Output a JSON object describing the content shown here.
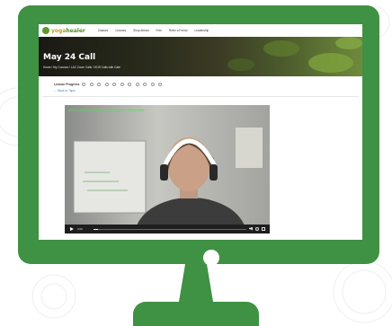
{
  "brand": {
    "logo_prefix": "yoga",
    "logo_suffix": "healer"
  },
  "nav": {
    "items": [
      "Classes",
      "Courses",
      "Shop Ahead",
      "Free",
      "Refer a Friend",
      "Leadership"
    ]
  },
  "hero": {
    "title": "May 24 Call",
    "breadcrumb": "Home / My Courses / LAC Zoom Calls / 2019 Calls with Cate"
  },
  "lesson": {
    "progress_label": "Lesson Progress",
    "progress_steps": 11,
    "back_link": "← Back to Topic"
  },
  "video": {
    "filename": "GMT20190524-210459_Living-Ayu_1920x1080",
    "time": "0:00",
    "progress_fraction": 0.03
  },
  "colors": {
    "device_green": "#3f9143",
    "link_blue": "#4a7ec2",
    "video_text_green": "#4ee24a"
  }
}
